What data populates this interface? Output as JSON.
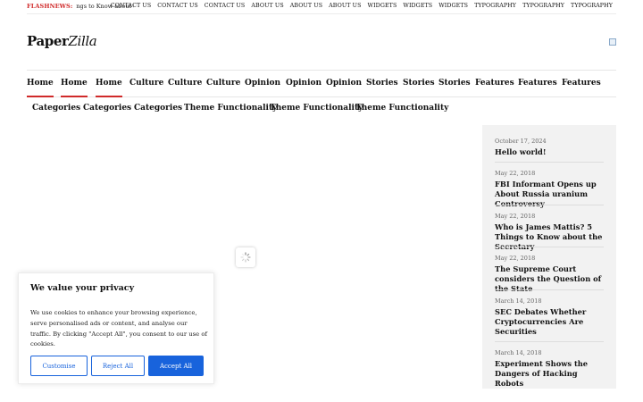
{
  "topbar": {
    "flash_label": "FLASHNEWS:",
    "flash_text": "ngs to Know about the Secr",
    "links": [
      "CONTACT US",
      "CONTACT US",
      "CONTACT US",
      "ABOUT US",
      "ABOUT US",
      "ABOUT US",
      "WIDGETS",
      "WIDGETS",
      "WIDGETS",
      "TYPOGRAPHY",
      "TYPOGRAPHY",
      "TYPOGRAPHY"
    ]
  },
  "logo": {
    "part1": "Paper",
    "part2": "Zilla"
  },
  "main_nav": {
    "items": [
      "Home",
      "Home",
      "Home",
      "Culture",
      "Culture",
      "Culture",
      "Opinion",
      "Opinion",
      "Opinion",
      "Stories",
      "Stories",
      "Stories",
      "Features",
      "Features",
      "Features"
    ],
    "accent_color": "#d02a2a"
  },
  "sub_nav": {
    "items": [
      "Categories",
      "Categories",
      "Categories",
      "Theme Functionality",
      "Theme Functionality",
      "Theme Functionality"
    ]
  },
  "sidebar": {
    "posts": [
      {
        "date": "October 17, 2024",
        "title": "Hello world!"
      },
      {
        "date": "May 22, 2018",
        "title": "FBI Informant Opens up About Russia uranium Controversy"
      },
      {
        "date": "May 22, 2018",
        "title": "Who is James Mattis? 5 Things to Know about the Secretary"
      },
      {
        "date": "May 22, 2018",
        "title": "The Supreme Court considers the Question of the State"
      },
      {
        "date": "March 14, 2018",
        "title": "SEC Debates Whether Cryptocurrencies Are Securities"
      },
      {
        "date": "March 14, 2018",
        "title": "Experiment Shows the Dangers of Hacking Robots"
      }
    ]
  },
  "cookie": {
    "title": "We value your privacy",
    "text": "We use cookies to enhance your browsing experience, serve personalised ads or content, and analyse our traffic. By clicking \"Accept All\", you consent to our use of cookies.",
    "customise_label": "Customise",
    "reject_label": "Reject All",
    "accept_label": "Accept All",
    "button_color": "#1863dc"
  }
}
